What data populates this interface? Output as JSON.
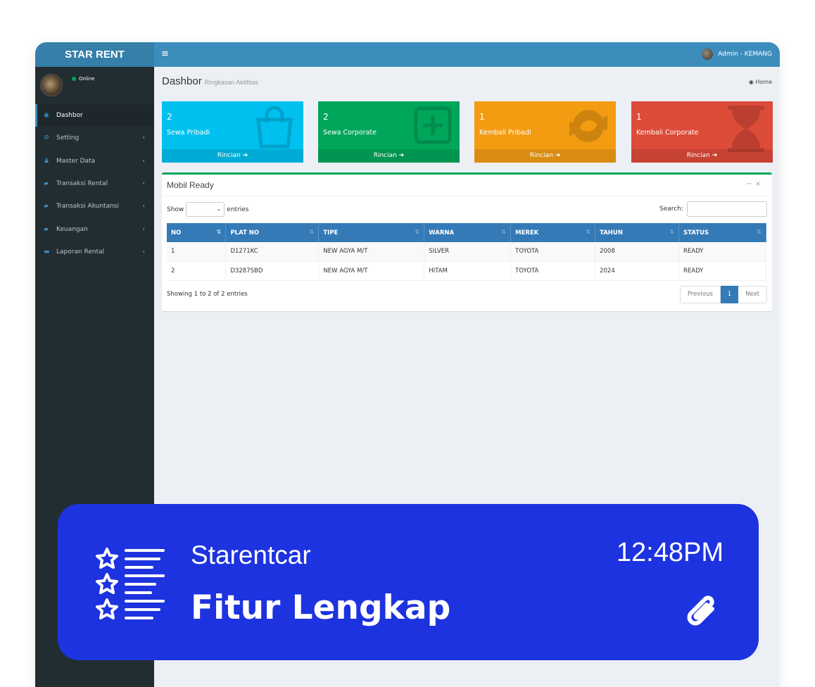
{
  "app": {
    "logo": "STAR RENT",
    "admin": "Admin - KEMANG",
    "menu_toggle": "≡"
  },
  "sidebar": {
    "status": "Online",
    "items": [
      {
        "label": "Dashbor",
        "icon": "dashboard-icon",
        "active": true
      },
      {
        "label": "Setting",
        "icon": "cogs-icon"
      },
      {
        "label": "Master Data",
        "icon": "users-icon"
      },
      {
        "label": "Transaksi Rental",
        "icon": "book-icon"
      },
      {
        "label": "Transaksi Akuntansi",
        "icon": "book-icon"
      },
      {
        "label": "Keuangan",
        "icon": "book-icon"
      },
      {
        "label": "Laporan Rental",
        "icon": "truck-icon"
      }
    ]
  },
  "header": {
    "title": "Dashbor",
    "subtitle": "Ringkasan Aktifitas",
    "breadcrumb": "Home"
  },
  "cards": [
    {
      "count": "2",
      "label": "Sewa Pribadi",
      "link": "Rincian",
      "color": "#00c0ef",
      "icon": "shopping-bag-icon"
    },
    {
      "count": "2",
      "label": "Sewa Corporate",
      "link": "Rincian",
      "color": "#00a65a",
      "icon": "plus-square-icon"
    },
    {
      "count": "1",
      "label": "Kembali Pribadi",
      "link": "Rincian",
      "color": "#f39c12",
      "icon": "refresh-icon"
    },
    {
      "count": "1",
      "label": "Kembali Corporate",
      "link": "Rincian",
      "color": "#dd4b39",
      "icon": "hourglass-icon"
    }
  ],
  "box": {
    "title": "Mobil Ready",
    "show_label": "Show",
    "entries_label": "entries",
    "search_label": "Search:",
    "columns": [
      "NO",
      "PLAT NO",
      "TIPE",
      "WARNA",
      "MEREK",
      "TAHUN",
      "STATUS"
    ],
    "rows": [
      [
        "1",
        "D1271KC",
        "NEW AGYA M/T",
        "SILVER",
        "TOYOTA",
        "2008",
        "READY"
      ],
      [
        "2",
        "D3287SBD",
        "NEW AGYA M/T",
        "HITAM",
        "TOYOTA",
        "2024",
        "READY"
      ]
    ],
    "info": "Showing 1 to 2 of 2 entries",
    "pager": {
      "prev": "Previous",
      "page": "1",
      "next": "Next"
    }
  },
  "banner": {
    "brand": "Starentcar",
    "title": "Fitur Lengkap",
    "time": "12:48PM",
    "color": "#1d33df"
  }
}
